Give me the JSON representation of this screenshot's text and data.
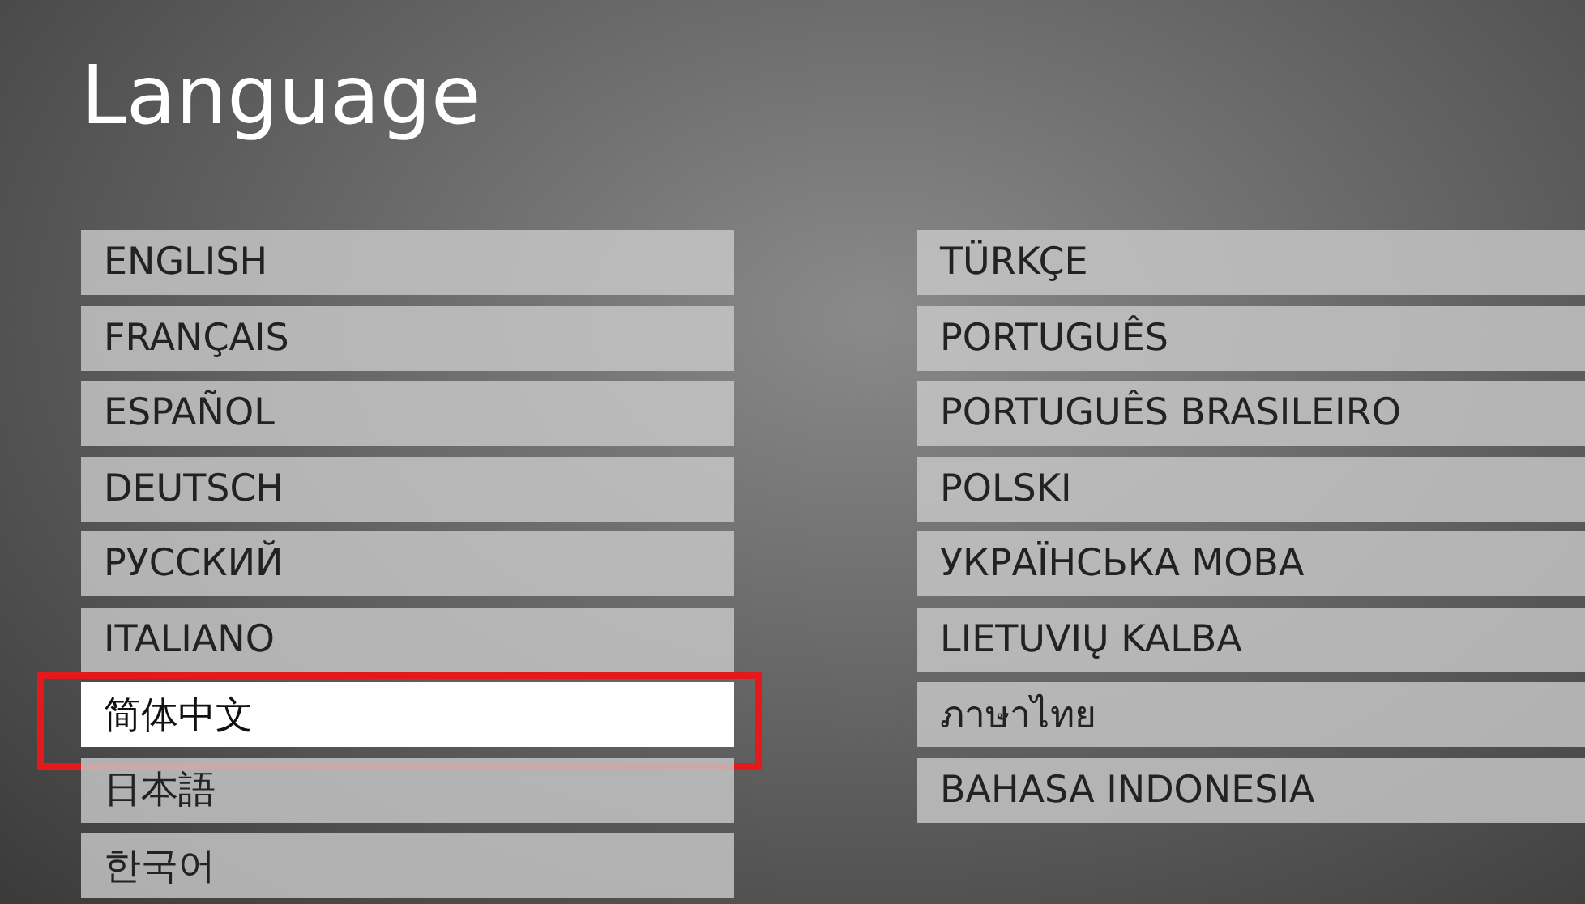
{
  "title": "Language",
  "columns": [
    [
      {
        "label": "ENGLISH",
        "selected": false,
        "highlighted": false
      },
      {
        "label": "FRANÇAIS",
        "selected": false,
        "highlighted": false
      },
      {
        "label": "ESPAÑOL",
        "selected": false,
        "highlighted": false
      },
      {
        "label": "DEUTSCH",
        "selected": false,
        "highlighted": false
      },
      {
        "label": "РУССКИЙ",
        "selected": false,
        "highlighted": false
      },
      {
        "label": "ITALIANO",
        "selected": false,
        "highlighted": false
      },
      {
        "label": "简体中文",
        "selected": true,
        "highlighted": true
      },
      {
        "label": "日本語",
        "selected": false,
        "highlighted": false
      },
      {
        "label": "한국어",
        "selected": false,
        "highlighted": false
      }
    ],
    [
      {
        "label": "TÜRKÇE",
        "selected": false,
        "highlighted": false
      },
      {
        "label": "PORTUGUÊS",
        "selected": false,
        "highlighted": false
      },
      {
        "label": "PORTUGUÊS BRASILEIRO",
        "selected": false,
        "highlighted": false
      },
      {
        "label": "POLSKI",
        "selected": false,
        "highlighted": false
      },
      {
        "label": "УКРАЇНСЬКА МОВА",
        "selected": false,
        "highlighted": false
      },
      {
        "label": "LIETUVIŲ KALBA",
        "selected": false,
        "highlighted": false
      },
      {
        "label": "ภาษาไทย",
        "selected": false,
        "highlighted": false
      },
      {
        "label": "BAHASA INDONESIA",
        "selected": false,
        "highlighted": false
      }
    ]
  ]
}
